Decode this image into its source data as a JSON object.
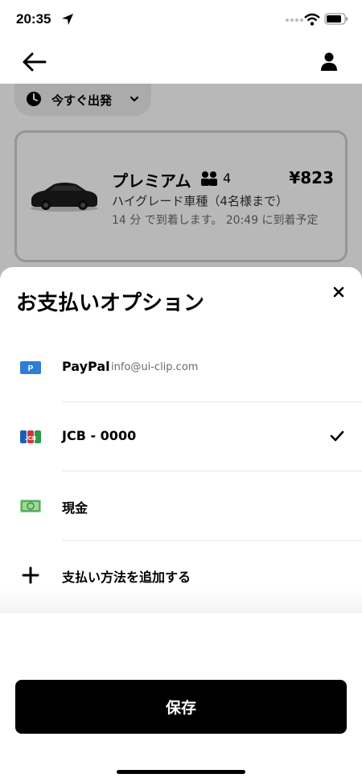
{
  "status_bar": {
    "time": "20:35"
  },
  "departure": {
    "label": "今すぐ出発"
  },
  "ride": {
    "name": "プレミアム",
    "capacity": "4",
    "price": "¥823",
    "description": "ハイグレード車種（4名様まで）",
    "eta": "14 分 で到着します。 20:49 に到着予定"
  },
  "sheet": {
    "title": "お支払いオプション",
    "options": [
      {
        "label": "PayPal",
        "sub": "info@ui-clip.com",
        "icon": "paypal-icon"
      },
      {
        "label": "JCB - 0000",
        "icon": "jcb-icon",
        "selected": true
      },
      {
        "label": "現金",
        "icon": "cash-icon"
      },
      {
        "label": "支払い方法を追加する",
        "icon": "plus-icon"
      }
    ],
    "save_label": "保存"
  },
  "colors": {
    "accent": "#000000",
    "paypal": "#2e7dd7",
    "cash": "#7dc87a"
  }
}
